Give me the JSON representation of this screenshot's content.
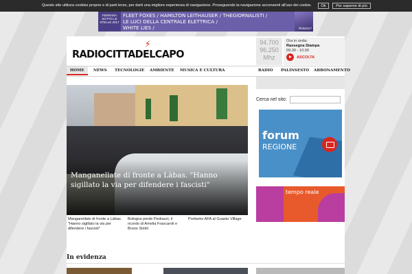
{
  "cookie": {
    "message": "Questo sito utilizza cookies proprie e di parti terze, per darti una migliore esperienza di navigazione. Proseguendo la navigazione acconsenti all'uso dei cookie.",
    "ok_label": "Ok",
    "more_label": "Per saperne di più"
  },
  "banner": {
    "left_text": "FERRARA SOTTO LE STELLE 2017",
    "line1": "FLEET FOXES / HAMILTON LEITHAUSER / THEGIORNALISTI /",
    "line2": "LE LUCI DELLA CENTRALE ELETTRICA /",
    "line3": "WHITE LIES /",
    "hashtag": "#fsls2017"
  },
  "header": {
    "logo": "RADIOCITTADELCAPO",
    "freq1": "94.700",
    "freq2": "96.250",
    "freq_unit": "Mhz",
    "onair_label": "Ora in onda:",
    "onair_show": "Rassegna Stampa",
    "onair_time": "09.30 - 10.00",
    "listen_label": "ASCOLTA"
  },
  "nav": {
    "left": [
      "HOME",
      "NEWS",
      "TECNOLOGIE",
      "AMBIENTE",
      "MUSICA E CULTURA"
    ],
    "right": [
      "RADIO",
      "PALINSESTO",
      "ABBONAMENTO"
    ]
  },
  "hero": {
    "headline": "Manganellate di fronte a Làbas. \"Hanno sigillato la via per difendere i fascisti\""
  },
  "captions": [
    "Manganellate di fronte a Làbas. \"Hanno sigillato la via per difendere i fascisti\"",
    "Bologna perde Pedrazzi, il ricordo di Amelia Frascaroli e Bruno Simili",
    "Portiamo AFA al Guasto Village"
  ],
  "sidebar": {
    "search_label": "Cerca nel sito:",
    "forum_line1": "forum",
    "forum_line2": "REGIONE",
    "tempo_reale": "tempo reale"
  },
  "evidenza": {
    "title": "In evidenza"
  },
  "colors": {
    "accent": "#d8261f",
    "banner": "#6a5fa8",
    "forum": "#4a90c8",
    "tempo": "#e85a2c"
  }
}
